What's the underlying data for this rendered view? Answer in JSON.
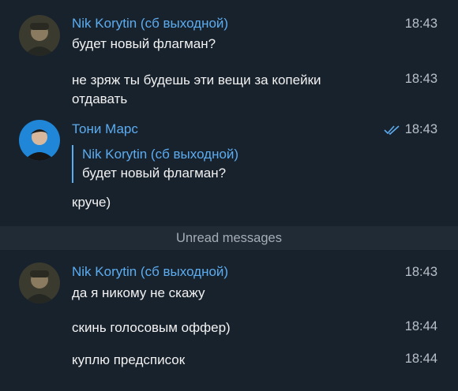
{
  "messages_top": [
    {
      "sender": "Nik Korytin (сб выходной)",
      "text": "будет новый флагман?",
      "time": "18:43"
    },
    {
      "text": "не зряж ты будешь эти вещи за копейки отдавать",
      "time": "18:43"
    }
  ],
  "toni": {
    "sender": "Тони Марс",
    "time": "18:43",
    "reply_sender": "Nik Korytin (сб выходной)",
    "reply_text": "будет новый флагман?",
    "text": "круче)"
  },
  "unread_label": "Unread messages",
  "messages_bottom": [
    {
      "sender": "Nik Korytin (сб выходной)",
      "text": "да я никому не скажу",
      "time": "18:43"
    },
    {
      "text": "скинь голосовым оффер)",
      "time": "18:44"
    },
    {
      "text": "куплю предсписок",
      "time": "18:44"
    }
  ],
  "colors": {
    "background": "#18222d",
    "accent": "#5cacf0",
    "unread_bar": "#202b36"
  }
}
